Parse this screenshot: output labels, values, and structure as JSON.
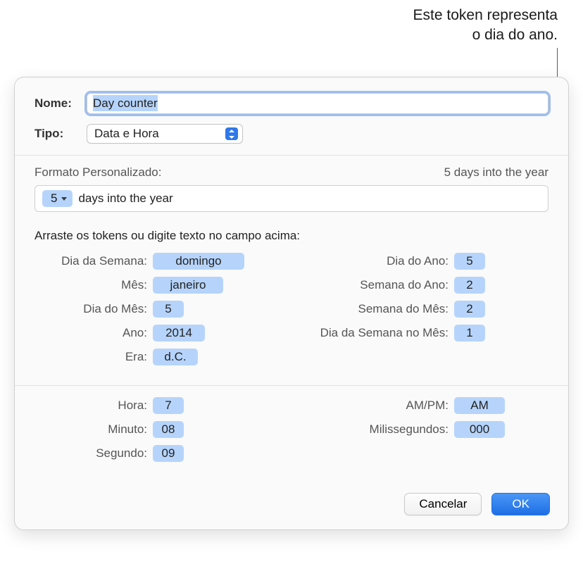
{
  "callout": {
    "line1": "Este token representa",
    "line2": "o dia do ano."
  },
  "form": {
    "name_label": "Nome:",
    "name_value": "Day counter",
    "type_label": "Tipo:",
    "type_value": "Data e Hora"
  },
  "format": {
    "label": "Formato Personalizado:",
    "preview": "5 days into the year",
    "token_value": "5",
    "trailing_text": "days into the year"
  },
  "instruction": "Arraste os tokens ou digite texto no campo acima:",
  "tokens": {
    "weekday": {
      "label": "Dia da Semana:",
      "value": "domingo"
    },
    "month": {
      "label": "Mês:",
      "value": "janeiro"
    },
    "day_of_month": {
      "label": "Dia do Mês:",
      "value": "5"
    },
    "year": {
      "label": "Ano:",
      "value": "2014"
    },
    "era": {
      "label": "Era:",
      "value": "d.C."
    },
    "day_of_year": {
      "label": "Dia do Ano:",
      "value": "5"
    },
    "week_of_year": {
      "label": "Semana do Ano:",
      "value": "2"
    },
    "week_of_month": {
      "label": "Semana do Mês:",
      "value": "2"
    },
    "weekday_in_month": {
      "label": "Dia da Semana no Mês:",
      "value": "1"
    },
    "hour": {
      "label": "Hora:",
      "value": "7"
    },
    "minute": {
      "label": "Minuto:",
      "value": "08"
    },
    "second": {
      "label": "Segundo:",
      "value": "09"
    },
    "ampm": {
      "label": "AM/PM:",
      "value": "AM"
    },
    "millis": {
      "label": "Milissegundos:",
      "value": "000"
    }
  },
  "buttons": {
    "cancel": "Cancelar",
    "ok": "OK"
  }
}
